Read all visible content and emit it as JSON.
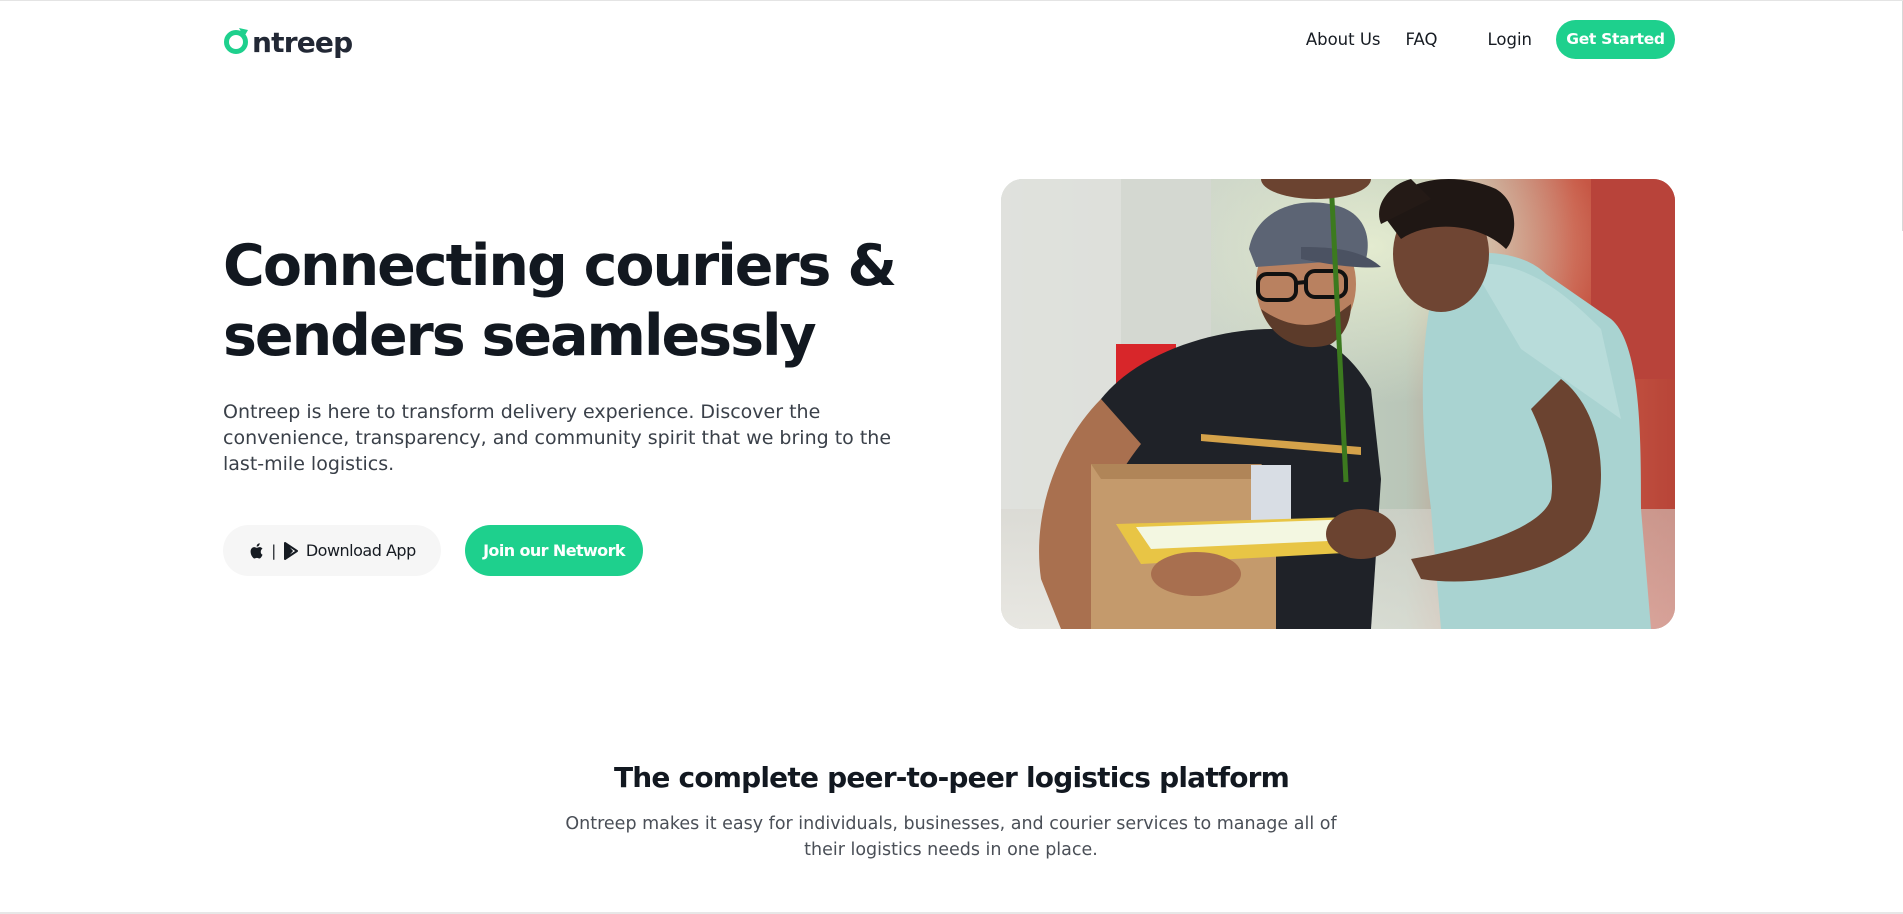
{
  "brand": {
    "name": "ntreep",
    "full_name": "Ontreep",
    "accent_color": "#1ed08d",
    "text_color": "#222835"
  },
  "nav": {
    "about": "About Us",
    "faq": "FAQ",
    "login": "Login",
    "get_started": "Get Started"
  },
  "hero": {
    "title_line1": "Connecting couriers &",
    "title_line2": "senders seamlessly",
    "subtitle": "Ontreep is here to transform delivery experience. Discover the convenience, transparency, and community spirit that we bring to the last-mile logistics.",
    "download_label": "Download App",
    "download_separator": "|",
    "download_icons": [
      "apple-icon",
      "play-store-icon"
    ],
    "join_label": "Join our Network",
    "photo_subject": "courier-handing-package"
  },
  "section": {
    "title": "The complete peer-to-peer logistics platform",
    "subtitle": "Ontreep makes it easy for individuals, businesses, and courier services to manage all of their logistics needs in one place."
  }
}
